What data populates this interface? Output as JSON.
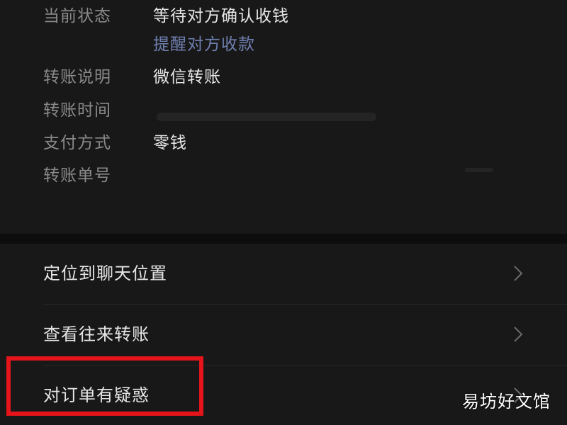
{
  "details": {
    "status_label": "当前状态",
    "status_value": "等待对方确认收钱",
    "remind_link": "提醒对方收款",
    "note_label": "转账说明",
    "note_value": "微信转账",
    "time_label": "转账时间",
    "time_value": "",
    "method_label": "支付方式",
    "method_value": "零钱",
    "order_label": "转账单号",
    "order_value": ""
  },
  "menu": {
    "items": [
      {
        "label": "定位到聊天位置"
      },
      {
        "label": "查看往来转账"
      },
      {
        "label": "对订单有疑惑"
      }
    ]
  },
  "watermark": "易坊好文馆",
  "colors": {
    "background": "#111111",
    "panel": "#181818",
    "label_gray": "#8a8a8a",
    "link_blue": "#6f7fb0",
    "highlight_red": "#e4141a"
  },
  "icons": {
    "row_chevron": "chevron-right-icon"
  }
}
